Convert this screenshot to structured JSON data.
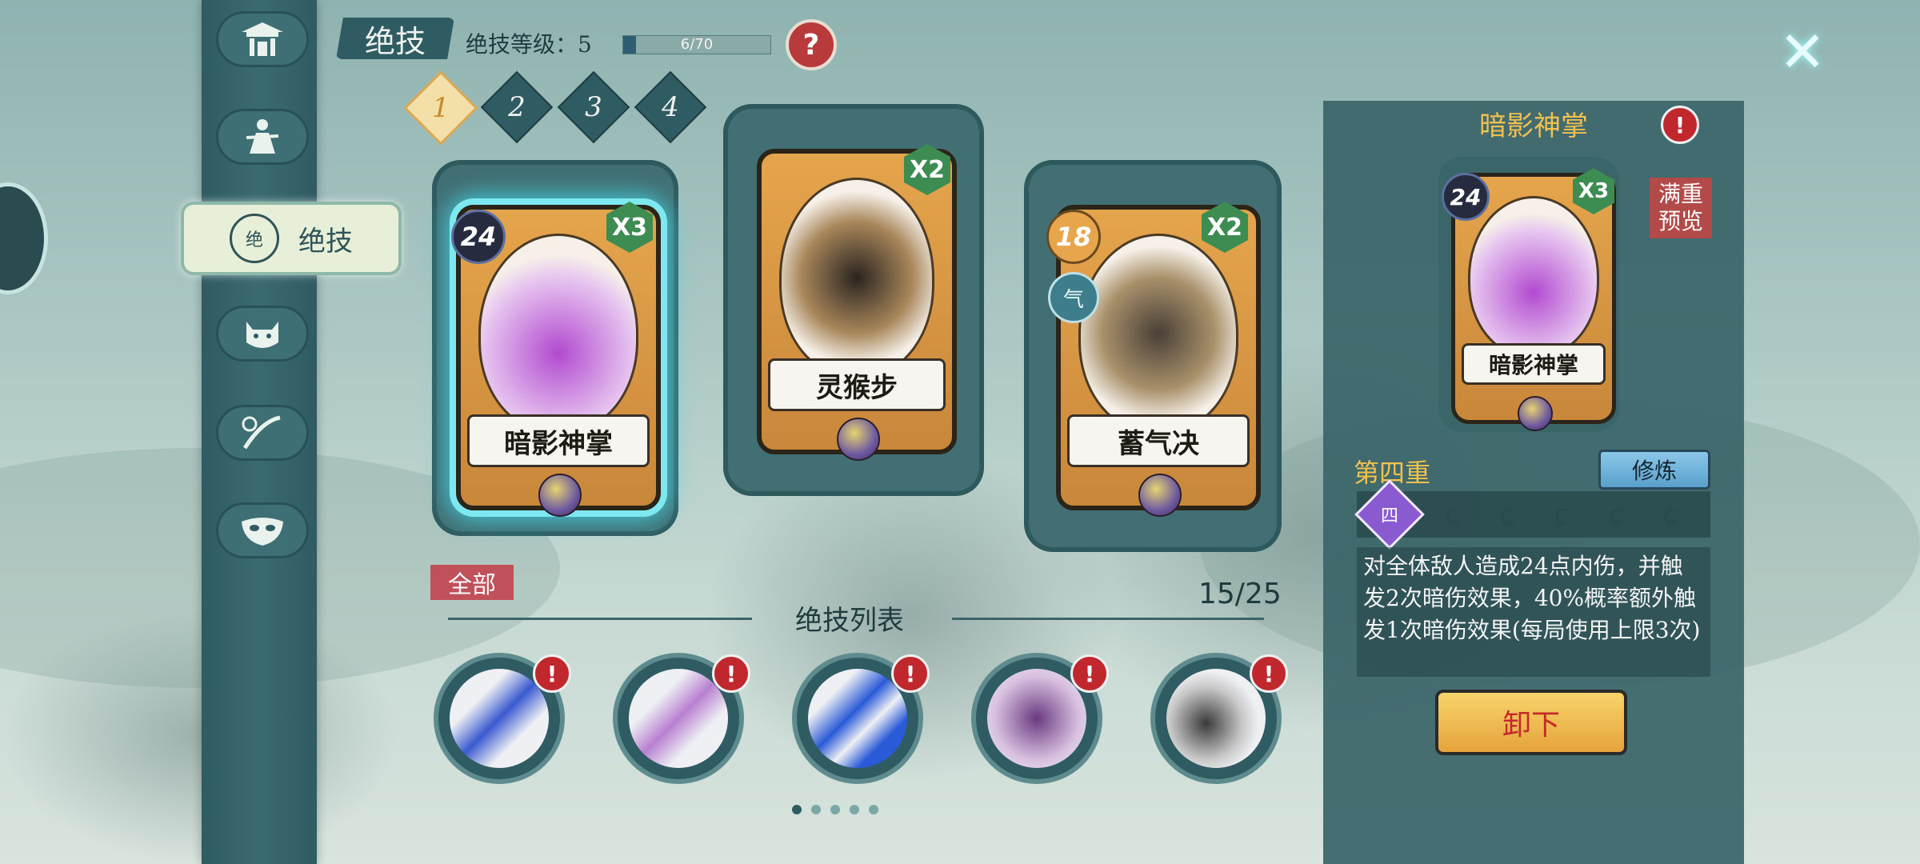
{
  "header": {
    "title": "绝技",
    "level_label": "绝技等级：5",
    "progress_text": "6/70",
    "progress_fraction": 0.0857,
    "help_icon": "question-icon",
    "close_icon": "close-icon"
  },
  "sidebar": {
    "active_label": "绝技",
    "active_emblem": "绝",
    "items": [
      {
        "icon": "pavilion-icon"
      },
      {
        "icon": "character-icon"
      },
      {
        "icon": "cat-icon"
      },
      {
        "icon": "weapon-icon"
      },
      {
        "icon": "mask-icon"
      }
    ]
  },
  "slots": [
    "1",
    "2",
    "3",
    "4"
  ],
  "equipped_cards": [
    {
      "name": "暗影神掌",
      "cost": "24",
      "multiplier": "X3"
    },
    {
      "name": "灵猴步",
      "cost": "",
      "multiplier": "X2"
    },
    {
      "name": "蓄气决",
      "cost": "18",
      "multiplier": "X2",
      "element": "气"
    }
  ],
  "list": {
    "filter": "全部",
    "title": "绝技列表",
    "count": "15/25",
    "page_count": 5,
    "current_page": 1
  },
  "detail": {
    "name": "暗影神掌",
    "cost": "24",
    "multiplier": "X3",
    "preview_label": "满重预览",
    "tier_label": "第四重",
    "tier_gem": "四",
    "train_button": "修炼",
    "description": "对全体敌人造成24点内伤，并触发2次暗伤效果，40%概率额外触发1次暗伤效果(每局使用上限3次)",
    "unequip_button": "卸下"
  },
  "colors": {
    "accent_gold": "#f2c14e",
    "alert_red": "#c0282e",
    "panel_teal": "#3a6468"
  }
}
